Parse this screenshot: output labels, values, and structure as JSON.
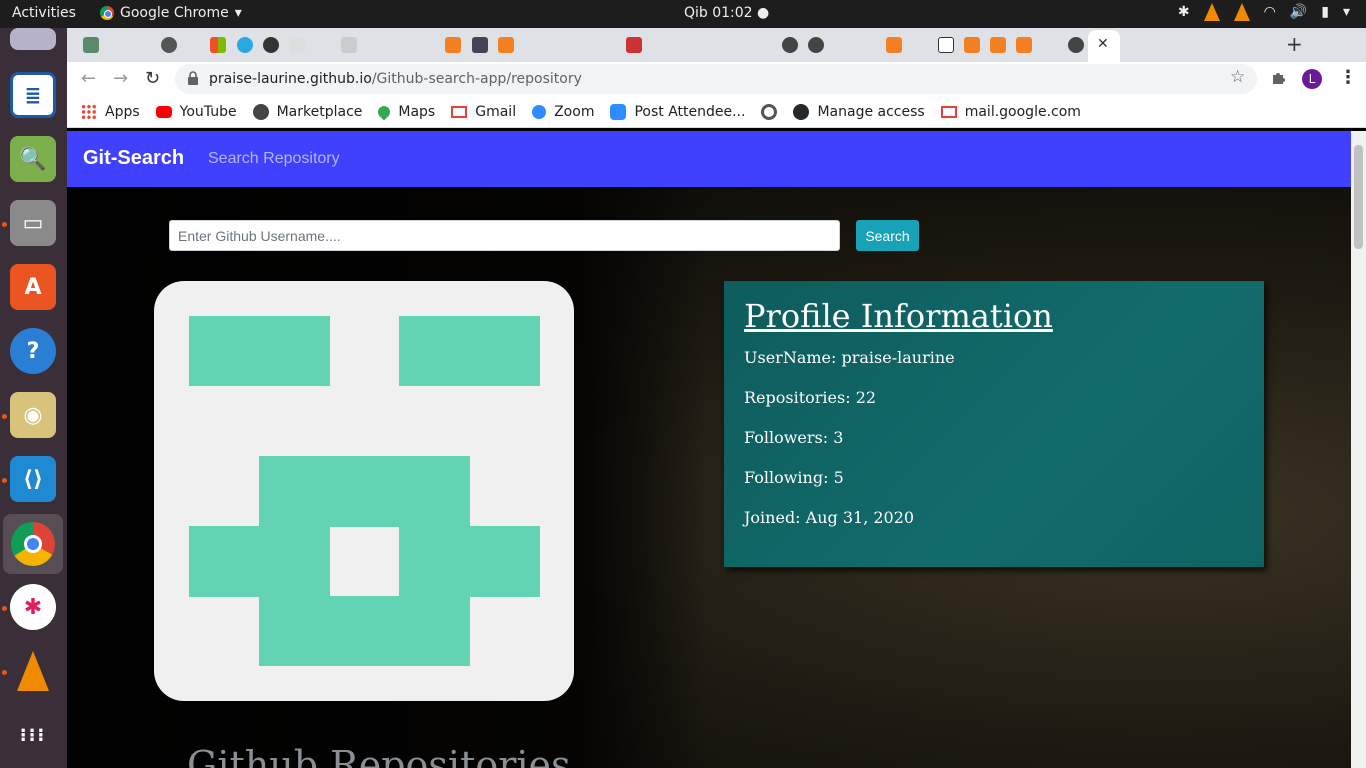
{
  "system": {
    "activities": "Activities",
    "app_name": "Google Chrome",
    "clock": "Qib 01:02 ●"
  },
  "browser": {
    "url_host": "praise-laurine.github.io",
    "url_path": "/Github-search-app/repository",
    "profile_initial": "L",
    "bookmarks": [
      {
        "label": "Apps",
        "icon": "apps-grid-icon"
      },
      {
        "label": "YouTube",
        "icon": "youtube-icon"
      },
      {
        "label": "Marketplace",
        "icon": "globe-icon"
      },
      {
        "label": "Maps",
        "icon": "maps-pin-icon"
      },
      {
        "label": "Gmail",
        "icon": "gmail-icon"
      },
      {
        "label": "Zoom",
        "icon": "zoom-icon"
      },
      {
        "label": "Post Attendee...",
        "icon": "zoom-camera-icon"
      },
      {
        "label": "",
        "icon": "circle-icon"
      },
      {
        "label": "Manage access",
        "icon": "github-icon"
      },
      {
        "label": "mail.google.com",
        "icon": "gmail-icon"
      }
    ]
  },
  "page": {
    "brand": "Git-Search",
    "nav_link": "Search Repository",
    "search_placeholder": "Enter Github Username....",
    "search_button": "Search",
    "profile": {
      "heading": "Profile Information",
      "username": "UserName: praise-laurine",
      "repositories": "Repositories: 22",
      "followers": "Followers: 3",
      "following": "Following: 5",
      "joined": "Joined: Aug 31, 2020"
    },
    "repo_heading": "Github Repositories"
  },
  "colors": {
    "navbar": "#4040ff",
    "search_button": "#17a2b8",
    "card": "#126b6b",
    "identicon": "#62d3b3"
  }
}
